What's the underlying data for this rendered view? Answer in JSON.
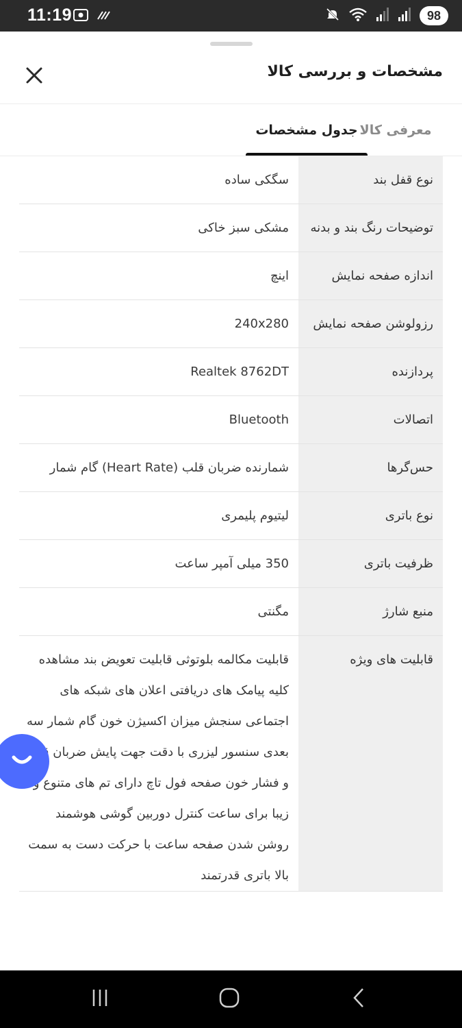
{
  "status_bar": {
    "time": "11:19",
    "battery": "98"
  },
  "sheet": {
    "title": "مشخصات و بررسی کالا"
  },
  "tabs": [
    {
      "label": "معرفی کالا",
      "active": false
    },
    {
      "label": "جدول مشخصات",
      "active": true
    }
  ],
  "specs": [
    {
      "label": "نوع قفل بند",
      "value": "سگکی ساده"
    },
    {
      "label": "توضیحات رنگ بند و بدنه",
      "value": "مشکی سبز خاکی"
    },
    {
      "label": "اندازه صفحه نمایش",
      "value": "اینچ"
    },
    {
      "label": "رزولوشن صفحه نمایش",
      "value": "240x280"
    },
    {
      "label": "پردازنده",
      "value": "Realtek 8762DT"
    },
    {
      "label": "اتصالات",
      "value": "Bluetooth"
    },
    {
      "label": "حس‌گرها",
      "value": "شمارنده ضربان قلب (Heart Rate) گام شمار"
    },
    {
      "label": "نوع باتری",
      "value": "لیتیوم پلیمری"
    },
    {
      "label": "ظرفیت باتری",
      "value": "350 میلی آمپر ساعت"
    },
    {
      "label": "منبع شارژ",
      "value": "مگنتی"
    },
    {
      "label": "قابلیت های ویژه",
      "value": "قابلیت مکالمه بلوتوثی قابلیت تعویض بند مشاهده کلیه پیامک های دریافتی اعلان های شبکه های اجتماعی سنجش میزان اکسیژن خون گام شمار سه بعدی سنسور لیزری با دقت جهت پایش ضربان قلب و فشار خون صفحه فول تاچ دارای تم های متنوع و زیبا برای ساعت کنترل دوربین گوشی هوشمند روشن شدن صفحه ساعت با حرکت دست به سمت بالا باتری قدرتمند"
    }
  ],
  "colors": {
    "label_bg": "#efefef",
    "chat_fab": "#4d6bfe",
    "tab_indicator": "#111111"
  },
  "icons": {
    "close": "close-icon",
    "chat": "chat-icon",
    "nav_recents": "recents-icon",
    "nav_home": "home-icon",
    "nav_back": "back-icon"
  }
}
